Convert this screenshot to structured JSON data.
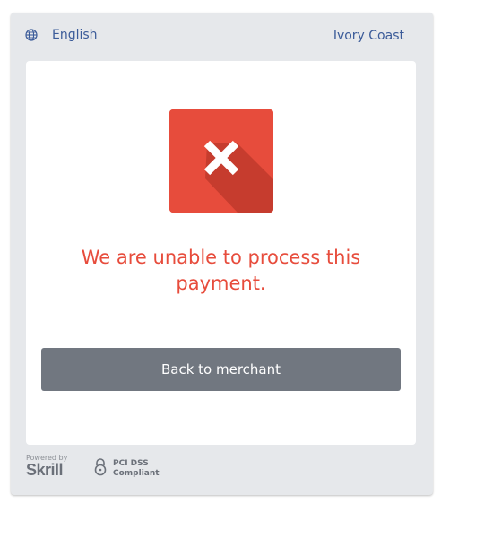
{
  "header": {
    "language_icon": "globe-icon",
    "language_label": "English",
    "country_label": "Ivory Coast"
  },
  "status": {
    "icon": "close-icon",
    "message": "We are unable to process this payment."
  },
  "actions": {
    "back_label": "Back to merchant"
  },
  "footer": {
    "powered_by": "Powered by",
    "brand": "Skrill",
    "pci_icon": "lock-icon",
    "pci_line1": "PCI DSS",
    "pci_line2": "Compliant"
  },
  "colors": {
    "error": "#e74c3c",
    "link": "#3b5b99",
    "button": "#717780",
    "frame": "#e6e8eb"
  }
}
